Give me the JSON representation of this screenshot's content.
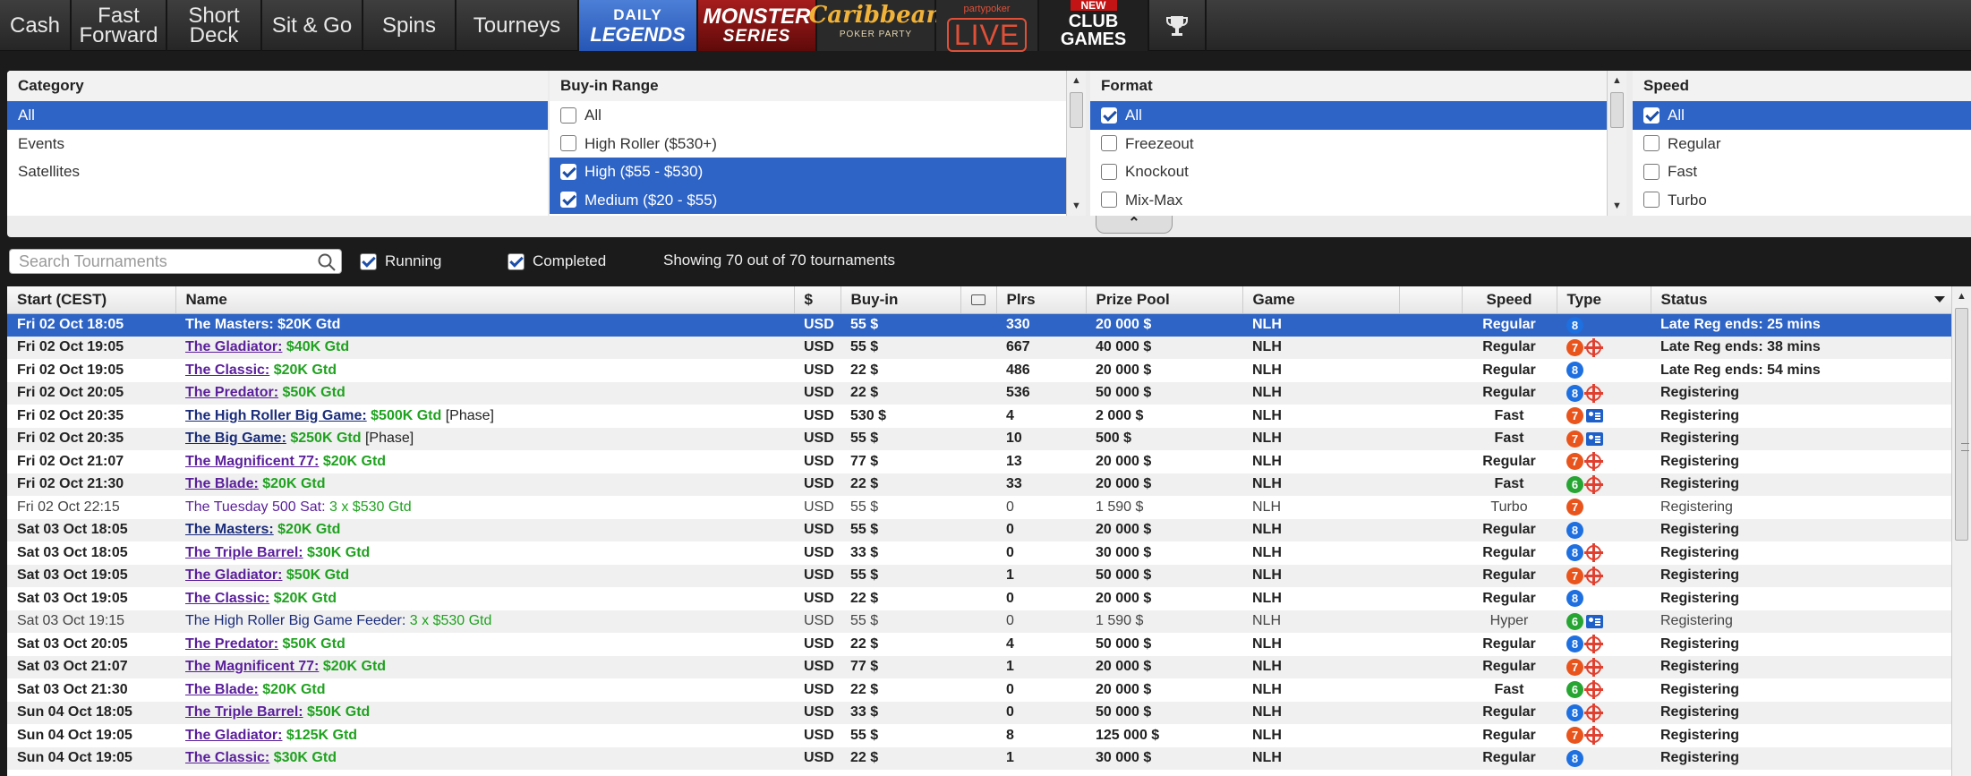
{
  "nav": {
    "tabs": [
      {
        "l1": "Cash",
        "l2": ""
      },
      {
        "l1": "Fast",
        "l2": "Forward"
      },
      {
        "l1": "Short",
        "l2": "Deck"
      },
      {
        "l1": "Sit & Go",
        "l2": ""
      },
      {
        "l1": "Spins",
        "l2": ""
      },
      {
        "l1": "Tourneys",
        "l2": ""
      }
    ],
    "daily": {
      "l1": "DAILY",
      "l2": "LEGENDS"
    },
    "monster": {
      "l1": "MONSTER",
      "l2": "SERIES"
    },
    "caribbean": {
      "l1": "Caribbean",
      "l2": "POKER PARTY"
    },
    "live": {
      "l1": "partypoker",
      "l2": "LIVE"
    },
    "club": {
      "badge": "NEW",
      "l1": "CLUB",
      "l2": "GAMES"
    },
    "trophy_icon": "trophy-icon"
  },
  "filters": {
    "category": {
      "header": "Category",
      "items": [
        {
          "label": "All",
          "selected": true
        },
        {
          "label": "Events",
          "selected": false
        },
        {
          "label": "Satellites",
          "selected": false
        }
      ]
    },
    "buyin": {
      "header": "Buy-in Range",
      "items": [
        {
          "label": "All",
          "checked": false,
          "selected": false
        },
        {
          "label": "High Roller ($530+)",
          "checked": false,
          "selected": false
        },
        {
          "label": "High ($55 - $530)",
          "checked": true,
          "selected": true
        },
        {
          "label": "Medium ($20 - $55)",
          "checked": true,
          "selected": true
        }
      ]
    },
    "format": {
      "header": "Format",
      "items": [
        {
          "label": "All",
          "checked": true,
          "selected": true
        },
        {
          "label": "Freezeout",
          "checked": false,
          "selected": false
        },
        {
          "label": "Knockout",
          "checked": false,
          "selected": false
        },
        {
          "label": "Mix-Max",
          "checked": false,
          "selected": false
        }
      ]
    },
    "speed": {
      "header": "Speed",
      "items": [
        {
          "label": "All",
          "checked": true,
          "selected": true
        },
        {
          "label": "Regular",
          "checked": false,
          "selected": false
        },
        {
          "label": "Fast",
          "checked": false,
          "selected": false
        },
        {
          "label": "Turbo",
          "checked": false,
          "selected": false
        }
      ]
    }
  },
  "search": {
    "placeholder": "Search Tournaments",
    "value": ""
  },
  "options": {
    "running": {
      "label": "Running",
      "checked": true
    },
    "completed": {
      "label": "Completed",
      "checked": true
    }
  },
  "showing_text": "Showing 70 out of 70 tournaments",
  "colors": {
    "selection": "#2e64c6",
    "gtd": "#1fa21f",
    "link": "#5a1f9a"
  },
  "table": {
    "headers": [
      "Start (CEST)",
      "Name",
      "$",
      "Buy-in",
      "",
      "Plrs",
      "Prize Pool",
      "Game",
      "",
      "Speed",
      "Type",
      "Status"
    ],
    "rows": [
      {
        "start": "Fri 02 Oct 18:05",
        "name": "The Masters:",
        "gtd": "$20K Gtd",
        "extra": "",
        "link": false,
        "dark": false,
        "cur": "USD",
        "buyin": "55 $",
        "plrs": "330",
        "prize": "20 000 $",
        "game": "NLH",
        "speed": "Regular",
        "badge": "8",
        "icon": "",
        "status": "Late Reg ends: 25 mins",
        "selected": true,
        "muted": false
      },
      {
        "start": "Fri 02 Oct 19:05",
        "name": "The Gladiator:",
        "gtd": "$40K Gtd",
        "extra": "",
        "link": true,
        "dark": false,
        "cur": "USD",
        "buyin": "55 $",
        "plrs": "667",
        "prize": "40 000 $",
        "game": "NLH",
        "speed": "Regular",
        "badge": "7",
        "icon": "knockout",
        "status": "Late Reg ends: 38 mins",
        "selected": false,
        "muted": false
      },
      {
        "start": "Fri 02 Oct 19:05",
        "name": "The Classic:",
        "gtd": "$20K Gtd",
        "extra": "",
        "link": true,
        "dark": false,
        "cur": "USD",
        "buyin": "22 $",
        "plrs": "486",
        "prize": "20 000 $",
        "game": "NLH",
        "speed": "Regular",
        "badge": "8",
        "icon": "",
        "status": "Late Reg ends: 54 mins",
        "selected": false,
        "muted": false
      },
      {
        "start": "Fri 02 Oct 20:05",
        "name": "The Predator:",
        "gtd": "$50K Gtd",
        "extra": "",
        "link": true,
        "dark": false,
        "cur": "USD",
        "buyin": "22 $",
        "plrs": "536",
        "prize": "50 000 $",
        "game": "NLH",
        "speed": "Regular",
        "badge": "8",
        "icon": "knockout",
        "status": "Registering",
        "selected": false,
        "muted": false
      },
      {
        "start": "Fri 02 Oct 20:35",
        "name": "The High Roller Big Game:",
        "gtd": "$500K Gtd",
        "extra": "[Phase]",
        "link": true,
        "dark": true,
        "cur": "USD",
        "buyin": "530 $",
        "plrs": "4",
        "prize": "2 000 $",
        "game": "NLH",
        "speed": "Fast",
        "badge": "7",
        "icon": "ticket",
        "status": "Registering",
        "selected": false,
        "muted": false
      },
      {
        "start": "Fri 02 Oct 20:35",
        "name": "The Big Game:",
        "gtd": "$250K Gtd",
        "extra": "[Phase]",
        "link": true,
        "dark": true,
        "cur": "USD",
        "buyin": "55 $",
        "plrs": "10",
        "prize": "500 $",
        "game": "NLH",
        "speed": "Fast",
        "badge": "7",
        "icon": "ticket",
        "status": "Registering",
        "selected": false,
        "muted": false
      },
      {
        "start": "Fri 02 Oct 21:07",
        "name": "The Magnificent 77:",
        "gtd": "$20K Gtd",
        "extra": "",
        "link": true,
        "dark": false,
        "cur": "USD",
        "buyin": "77 $",
        "plrs": "13",
        "prize": "20 000 $",
        "game": "NLH",
        "speed": "Regular",
        "badge": "7",
        "icon": "knockout",
        "status": "Registering",
        "selected": false,
        "muted": false
      },
      {
        "start": "Fri 02 Oct 21:30",
        "name": "The Blade:",
        "gtd": "$20K Gtd",
        "extra": "",
        "link": true,
        "dark": false,
        "cur": "USD",
        "buyin": "22 $",
        "plrs": "33",
        "prize": "20 000 $",
        "game": "NLH",
        "speed": "Fast",
        "badge": "6",
        "icon": "knockout",
        "status": "Registering",
        "selected": false,
        "muted": false
      },
      {
        "start": "Fri 02 Oct 22:15",
        "name": "The Tuesday 500 Sat:",
        "gtd": "3 x $530 Gtd",
        "extra": "",
        "link": false,
        "dark": false,
        "cur": "USD",
        "buyin": "55 $",
        "plrs": "0",
        "prize": "1 590 $",
        "game": "NLH",
        "speed": "Turbo",
        "badge": "7",
        "icon": "",
        "status": "Registering",
        "selected": false,
        "muted": true
      },
      {
        "start": "Sat 03 Oct 18:05",
        "name": "The Masters:",
        "gtd": "$20K Gtd",
        "extra": "",
        "link": true,
        "dark": true,
        "cur": "USD",
        "buyin": "55 $",
        "plrs": "0",
        "prize": "20 000 $",
        "game": "NLH",
        "speed": "Regular",
        "badge": "8",
        "icon": "",
        "status": "Registering",
        "selected": false,
        "muted": false
      },
      {
        "start": "Sat 03 Oct 18:05",
        "name": "The Triple Barrel:",
        "gtd": "$30K Gtd",
        "extra": "",
        "link": true,
        "dark": false,
        "cur": "USD",
        "buyin": "33 $",
        "plrs": "0",
        "prize": "30 000 $",
        "game": "NLH",
        "speed": "Regular",
        "badge": "8",
        "icon": "knockout",
        "status": "Registering",
        "selected": false,
        "muted": false
      },
      {
        "start": "Sat 03 Oct 19:05",
        "name": "The Gladiator:",
        "gtd": "$50K Gtd",
        "extra": "",
        "link": true,
        "dark": false,
        "cur": "USD",
        "buyin": "55 $",
        "plrs": "1",
        "prize": "50 000 $",
        "game": "NLH",
        "speed": "Regular",
        "badge": "7",
        "icon": "knockout",
        "status": "Registering",
        "selected": false,
        "muted": false
      },
      {
        "start": "Sat 03 Oct 19:05",
        "name": "The Classic:",
        "gtd": "$20K Gtd",
        "extra": "",
        "link": true,
        "dark": false,
        "cur": "USD",
        "buyin": "22 $",
        "plrs": "0",
        "prize": "20 000 $",
        "game": "NLH",
        "speed": "Regular",
        "badge": "8",
        "icon": "",
        "status": "Registering",
        "selected": false,
        "muted": false
      },
      {
        "start": "Sat 03 Oct 19:15",
        "name": "The High Roller Big Game Feeder:",
        "gtd": "3 x $530 Gtd",
        "extra": "",
        "link": false,
        "dark": true,
        "cur": "USD",
        "buyin": "55 $",
        "plrs": "0",
        "prize": "1 590 $",
        "game": "NLH",
        "speed": "Hyper",
        "badge": "6",
        "icon": "ticket",
        "status": "Registering",
        "selected": false,
        "muted": true
      },
      {
        "start": "Sat 03 Oct 20:05",
        "name": "The Predator:",
        "gtd": "$50K Gtd",
        "extra": "",
        "link": true,
        "dark": false,
        "cur": "USD",
        "buyin": "22 $",
        "plrs": "4",
        "prize": "50 000 $",
        "game": "NLH",
        "speed": "Regular",
        "badge": "8",
        "icon": "knockout",
        "status": "Registering",
        "selected": false,
        "muted": false
      },
      {
        "start": "Sat 03 Oct 21:07",
        "name": "The Magnificent 77:",
        "gtd": "$20K Gtd",
        "extra": "",
        "link": true,
        "dark": false,
        "cur": "USD",
        "buyin": "77 $",
        "plrs": "1",
        "prize": "20 000 $",
        "game": "NLH",
        "speed": "Regular",
        "badge": "7",
        "icon": "knockout",
        "status": "Registering",
        "selected": false,
        "muted": false
      },
      {
        "start": "Sat 03 Oct 21:30",
        "name": "The Blade:",
        "gtd": "$20K Gtd",
        "extra": "",
        "link": true,
        "dark": false,
        "cur": "USD",
        "buyin": "22 $",
        "plrs": "0",
        "prize": "20 000 $",
        "game": "NLH",
        "speed": "Fast",
        "badge": "6",
        "icon": "knockout",
        "status": "Registering",
        "selected": false,
        "muted": false
      },
      {
        "start": "Sun 04 Oct 18:05",
        "name": "The Triple Barrel:",
        "gtd": "$50K Gtd",
        "extra": "",
        "link": true,
        "dark": false,
        "cur": "USD",
        "buyin": "33 $",
        "plrs": "0",
        "prize": "50 000 $",
        "game": "NLH",
        "speed": "Regular",
        "badge": "8",
        "icon": "knockout",
        "status": "Registering",
        "selected": false,
        "muted": false
      },
      {
        "start": "Sun 04 Oct 19:05",
        "name": "The Gladiator:",
        "gtd": "$125K Gtd",
        "extra": "",
        "link": true,
        "dark": false,
        "cur": "USD",
        "buyin": "55 $",
        "plrs": "8",
        "prize": "125 000 $",
        "game": "NLH",
        "speed": "Regular",
        "badge": "7",
        "icon": "knockout",
        "status": "Registering",
        "selected": false,
        "muted": false
      },
      {
        "start": "Sun 04 Oct 19:05",
        "name": "The Classic:",
        "gtd": "$30K Gtd",
        "extra": "",
        "link": true,
        "dark": false,
        "cur": "USD",
        "buyin": "22 $",
        "plrs": "1",
        "prize": "30 000 $",
        "game": "NLH",
        "speed": "Regular",
        "badge": "8",
        "icon": "",
        "status": "Registering",
        "selected": false,
        "muted": false
      }
    ]
  }
}
